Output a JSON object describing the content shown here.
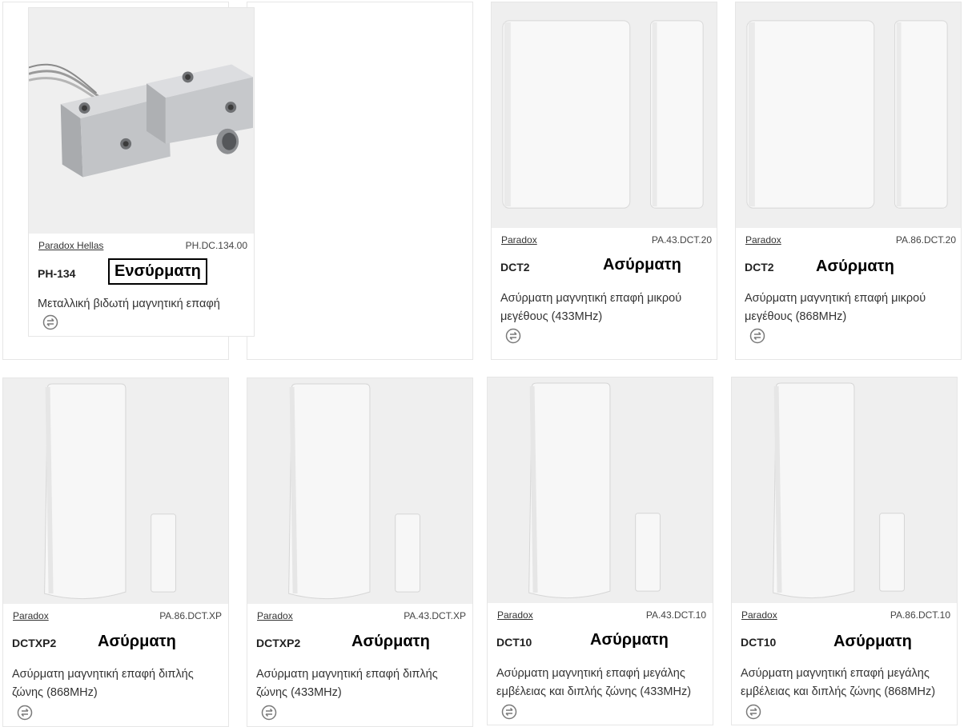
{
  "products": [
    {
      "brand": "Paradox Hellas",
      "sku": "PH.DC.134.00",
      "code": "PH-134",
      "tag": "Ενσύρματη",
      "description": "Μεταλλική βιδωτή μαγνητική επαφή",
      "image": "metal-contact"
    },
    {
      "brand": "Paradox",
      "sku": "PA.43.DCT.20",
      "code": "DCT2",
      "tag": "Ασύρματη",
      "description": "Ασύρματη μαγνητική επαφή μικρού μεγέθους (433MHz)",
      "image": "dct2"
    },
    {
      "brand": "Paradox",
      "sku": "PA.86.DCT.20",
      "code": "DCT2",
      "tag": "Ασύρματη",
      "description": "Ασύρματη μαγνητική επαφή μικρού μεγέθους (868MHz)",
      "image": "dct2"
    },
    {
      "brand": "Paradox",
      "sku": "PA.86.DCT.XP",
      "code": "DCTXP2",
      "tag": "Ασύρματη",
      "description": "Ασύρματη μαγνητική επαφή διπλής ζώνης (868MHz)",
      "image": "dctxp"
    },
    {
      "brand": "Paradox",
      "sku": "PA.43.DCT.XP",
      "code": "DCTXP2",
      "tag": "Ασύρματη",
      "description": "Ασύρματη μαγνητική επαφή διπλής ζώνης (433MHz)",
      "image": "dctxp"
    },
    {
      "brand": "Paradox",
      "sku": "PA.43.DCT.10",
      "code": "DCT10",
      "tag": "Ασύρματη",
      "description": "Ασύρματη μαγνητική επαφή μεγάλης εμβέλειας και διπλής ζώνης (433MHz)",
      "image": "dctxp"
    },
    {
      "brand": "Paradox",
      "sku": "PA.86.DCT.10",
      "code": "DCT10",
      "tag": "Ασύρματη",
      "description": "Ασύρματη μαγνητική επαφή μεγάλης εμβέλειας και διπλής ζώνης (868MHz)",
      "image": "dctxp"
    }
  ],
  "icons": {
    "compare": "compare-arrows-icon"
  },
  "colors": {
    "image_bg": "#efefef",
    "text": "#333333",
    "border": "#e6e6e6"
  }
}
